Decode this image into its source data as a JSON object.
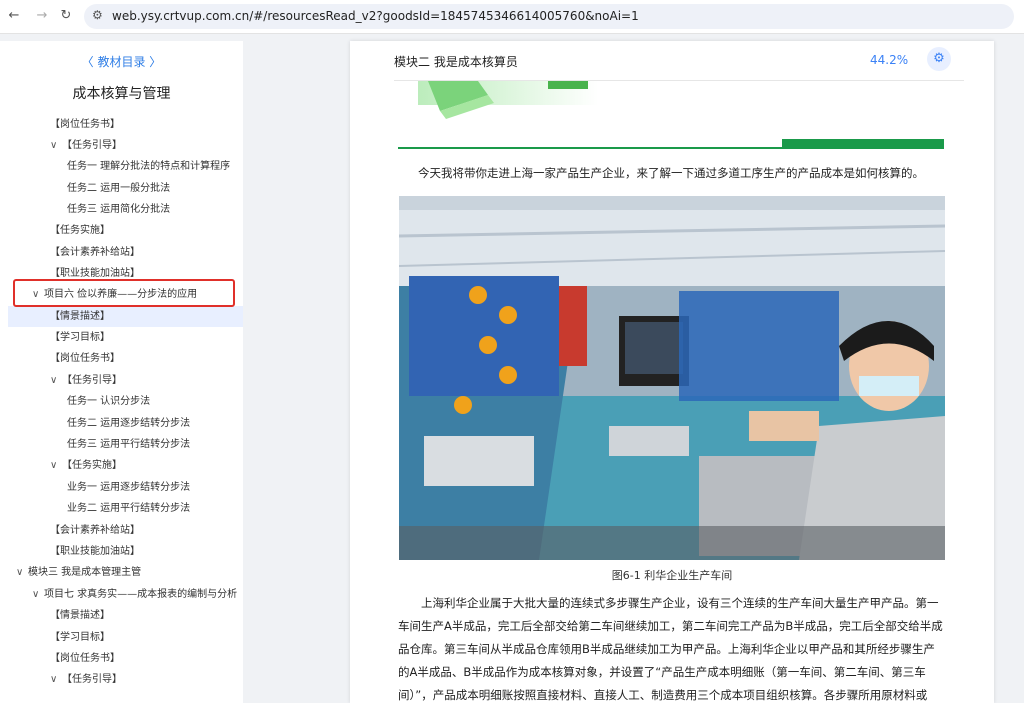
{
  "browser": {
    "url": "web.ysy.crtvup.com.cn/#/resourcesRead_v2?goodsId=1845745346614005760&noAi=1"
  },
  "sidebar": {
    "header": "〈 教材目录 〉",
    "book_title": "成本核算与管理",
    "items": [
      {
        "label": "【岗位任务书】",
        "arrow": ""
      },
      {
        "label": "【任务引导】",
        "arrow": "∨"
      },
      {
        "label": "任务一 理解分批法的特点和计算程序",
        "arrow": ""
      },
      {
        "label": "任务二 运用一般分批法",
        "arrow": ""
      },
      {
        "label": "任务三 运用简化分批法",
        "arrow": ""
      },
      {
        "label": "【任务实施】",
        "arrow": ""
      },
      {
        "label": "【会计素养补给站】",
        "arrow": ""
      },
      {
        "label": "【职业技能加油站】",
        "arrow": ""
      },
      {
        "label": "项目六 俭以养廉——分步法的应用",
        "arrow": "∨"
      },
      {
        "label": "【情景描述】",
        "arrow": ""
      },
      {
        "label": "【学习目标】",
        "arrow": ""
      },
      {
        "label": "【岗位任务书】",
        "arrow": ""
      },
      {
        "label": "【任务引导】",
        "arrow": "∨"
      },
      {
        "label": "任务一 认识分步法",
        "arrow": ""
      },
      {
        "label": "任务二 运用逐步结转分步法",
        "arrow": ""
      },
      {
        "label": "任务三 运用平行结转分步法",
        "arrow": ""
      },
      {
        "label": "【任务实施】",
        "arrow": "∨"
      },
      {
        "label": "业务一 运用逐步结转分步法",
        "arrow": ""
      },
      {
        "label": "业务二 运用平行结转分步法",
        "arrow": ""
      },
      {
        "label": "【会计素养补给站】",
        "arrow": ""
      },
      {
        "label": "【职业技能加油站】",
        "arrow": ""
      },
      {
        "label": "模块三 我是成本管理主管",
        "arrow": "∨"
      },
      {
        "label": "项目七 求真务实——成本报表的编制与分析",
        "arrow": "∨"
      },
      {
        "label": "【情景描述】",
        "arrow": ""
      },
      {
        "label": "【学习目标】",
        "arrow": ""
      },
      {
        "label": "【岗位任务书】",
        "arrow": ""
      },
      {
        "label": "【任务引导】",
        "arrow": "∨"
      }
    ]
  },
  "reader": {
    "section_title": "模块二 我是成本核算员",
    "progress": "44.2%",
    "intro": "今天我将带你走进上海一家产品生产企业，来了解一下通过多道工序生产的产品成本是如何核算的。",
    "figure_caption": "图6-1 利华企业生产车间",
    "paragraph": "上海利华企业属于大批大量的连续式多步骤生产企业，设有三个连续的生产车间大量生产甲产品。第一车间生产A半成品，完工后全部交给第二车间继续加工，第二车间完工产品为B半成品，完工后全部交给半成品仓库。第三车间从半成品仓库领用B半成品继续加工为甲产品。上海利华企业以甲产品和其所经步骤生产的A半成品、B半成品作为成本核算对象，并设置了“产品生产成本明细账（第一车间、第二车间、第三车间）”，产品成本明细账按照直接材料、直接人工、制造费用三个成本项目组织核算。各步骤所用原材料或"
  }
}
